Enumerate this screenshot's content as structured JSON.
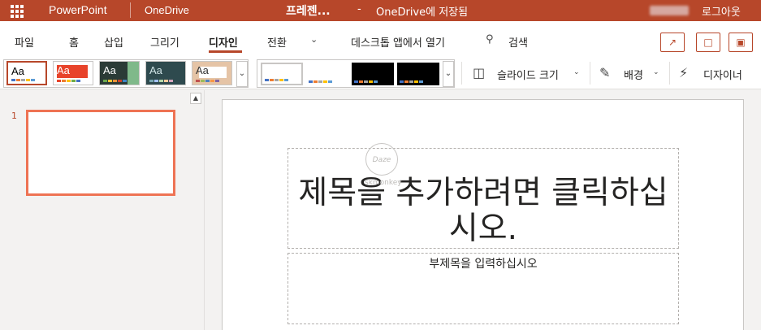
{
  "titlebar": {
    "app_name": "PowerPoint",
    "onedrive": "OneDrive",
    "doc_title": "프레젠...",
    "separator": "-",
    "save_status": "OneDrive에 저장됨",
    "logout": "로그아웃",
    "color": "#b7472a"
  },
  "tabs": [
    {
      "label": "파일"
    },
    {
      "label": "홈"
    },
    {
      "label": "삽입"
    },
    {
      "label": "그리기"
    },
    {
      "label": "디자인"
    },
    {
      "label": "전환"
    }
  ],
  "ribbon": {
    "open_desktop": "데스크톱 앱에서 열기",
    "search": "검색",
    "more_icon": "chevron-down-icon",
    "right_buttons": [
      "share-icon",
      "comment-icon",
      "present-icon"
    ]
  },
  "themes": [
    {
      "aa": "Aa",
      "bg": "#ffffff",
      "fg": "#000000"
    },
    {
      "aa": "Aa",
      "bg": "#e8432a",
      "fg": "#ffffff"
    },
    {
      "aa": "Aa",
      "bg": "#2b3b36",
      "fg": "#ffffff"
    },
    {
      "aa": "Aa",
      "bg": "#2e4a4e",
      "fg": "#ffffff"
    },
    {
      "aa": "Aa",
      "bg": "#e5c4a6",
      "fg": "#333333"
    }
  ],
  "variants": [
    {
      "bg": "#ffffff"
    },
    {
      "bg": "#ffffff"
    },
    {
      "bg": "#000000"
    },
    {
      "bg": "#000000"
    }
  ],
  "toolbar": {
    "slide_size": "슬라이드 크기",
    "background": "배경",
    "designer": "디자이너"
  },
  "thumbs": {
    "slide_number": "1",
    "accent": "#ee7354"
  },
  "slide": {
    "title": "제목을 추가하려면 클릭하십시오.",
    "subtitle": "부제목을 입력하십시오",
    "watermark": "Daze",
    "watermark_caption": "skmonkey"
  }
}
